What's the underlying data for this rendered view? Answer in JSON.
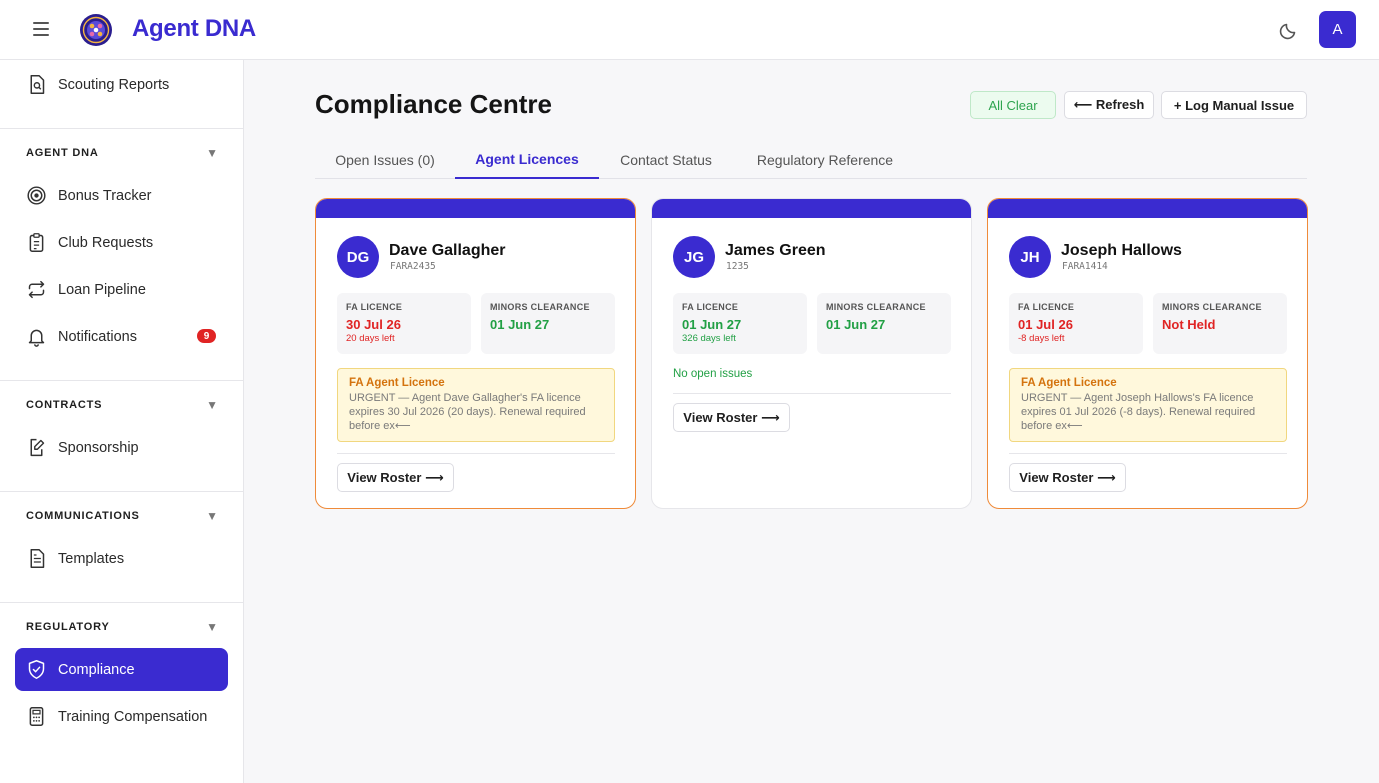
{
  "app": {
    "brand": "Agent DNA",
    "user_initial": "A"
  },
  "icons": {
    "menu": "menu-icon",
    "theme": "moon-icon",
    "logo": "globe-logo"
  },
  "colors": {
    "accent": "#3a2bd0",
    "danger": "#e02424",
    "success": "#22a045",
    "warning": "#d4730e"
  },
  "sidebar": {
    "top_items": [
      {
        "label": "Scouting Reports",
        "icon": "report-icon"
      }
    ],
    "sections": [
      {
        "title": "AGENT DNA",
        "items": [
          {
            "label": "Bonus Tracker",
            "icon": "target-icon"
          },
          {
            "label": "Club Requests",
            "icon": "clipboard-icon"
          },
          {
            "label": "Loan Pipeline",
            "icon": "repeat-icon"
          },
          {
            "label": "Notifications",
            "icon": "bell-icon",
            "badge": "9"
          }
        ]
      },
      {
        "title": "CONTRACTS",
        "items": [
          {
            "label": "Sponsorship",
            "icon": "edit-document-icon"
          }
        ]
      },
      {
        "title": "COMMUNICATIONS",
        "items": [
          {
            "label": "Templates",
            "icon": "document-icon"
          }
        ]
      },
      {
        "title": "REGULATORY",
        "items": [
          {
            "label": "Compliance",
            "icon": "shield-check-icon",
            "active": true
          },
          {
            "label": "Training Compensation",
            "icon": "calculator-icon"
          }
        ]
      }
    ]
  },
  "page": {
    "title": "Compliance Centre",
    "actions": {
      "all_clear": "All Clear",
      "refresh": "⟵ Refresh",
      "log_issue": "+ Log Manual Issue"
    },
    "tabs": [
      {
        "label": "Open Issues (0)"
      },
      {
        "label": "Agent Licences",
        "active": true
      },
      {
        "label": "Contact Status"
      },
      {
        "label": "Regulatory Reference"
      }
    ]
  },
  "cards": [
    {
      "initials": "DG",
      "name": "Dave Gallagher",
      "code": "FARA2435",
      "fa_label": "FA LICENCE",
      "fa_date": "30 Jul 26",
      "fa_days": "20 days left",
      "minors_label": "MINORS CLEARANCE",
      "minors_value": "01 Jun 27",
      "alert_title": "FA Agent Licence",
      "alert_body": "URGENT — Agent Dave Gallagher's FA licence expires 30 Jul 2026 (20 days). Renewal required before ex⟵",
      "roster": "View Roster ⟶"
    },
    {
      "initials": "JG",
      "name": "James Green",
      "code": "1235",
      "fa_label": "FA LICENCE",
      "fa_date": "01 Jun 27",
      "fa_days": "326 days left",
      "minors_label": "MINORS CLEARANCE",
      "minors_value": "01 Jun 27",
      "no_issues": "No open issues",
      "roster": "View Roster ⟶"
    },
    {
      "initials": "JH",
      "name": "Joseph Hallows",
      "code": "FARA1414",
      "fa_label": "FA LICENCE",
      "fa_date": "01 Jul 26",
      "fa_days": "-8 days left",
      "minors_label": "MINORS CLEARANCE",
      "minors_value": "Not Held",
      "alert_title": "FA Agent Licence",
      "alert_body": "URGENT — Agent Joseph Hallows's FA licence expires 01 Jul 2026 (-8 days). Renewal required before ex⟵",
      "roster": "View Roster ⟶"
    }
  ]
}
